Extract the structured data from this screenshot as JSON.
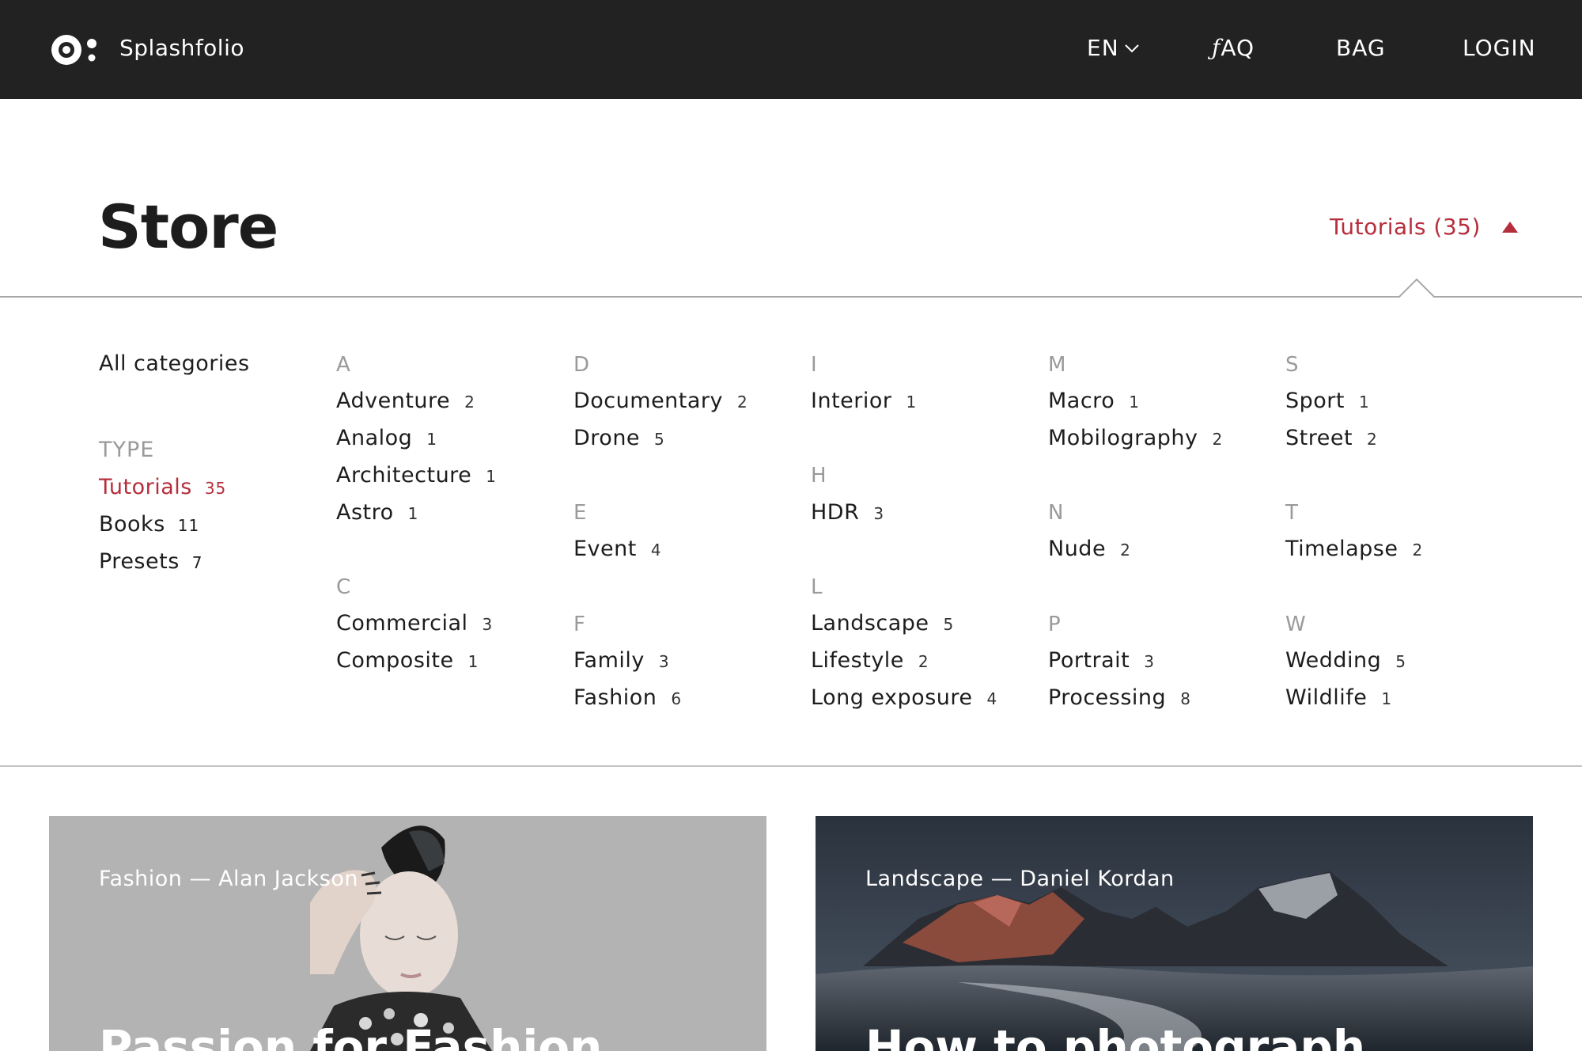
{
  "header": {
    "brand": "Splashfolio",
    "nav": {
      "lang": "EN",
      "faq_prefix": "ƒ",
      "faq_rest": "AQ",
      "bag": "BAG",
      "login": "LOGIN"
    }
  },
  "page": {
    "title": "Store",
    "filter_toggle": "Tutorials (35)"
  },
  "sidebar": {
    "all_categories": "All categories",
    "type_label": "TYPE",
    "types": [
      {
        "label": "Tutorials",
        "count": "35",
        "active": true
      },
      {
        "label": "Books",
        "count": "11"
      },
      {
        "label": "Presets",
        "count": "7"
      }
    ]
  },
  "categories": {
    "col1": [
      {
        "letter": "A",
        "items": [
          {
            "label": "Adventure",
            "count": "2"
          },
          {
            "label": "Analog",
            "count": "1"
          },
          {
            "label": "Architecture",
            "count": "1"
          },
          {
            "label": "Astro",
            "count": "1"
          }
        ]
      },
      {
        "letter": "C",
        "items": [
          {
            "label": "Commercial",
            "count": "3"
          },
          {
            "label": "Composite",
            "count": "1"
          }
        ]
      }
    ],
    "col2": [
      {
        "letter": "D",
        "items": [
          {
            "label": "Documentary",
            "count": "2"
          },
          {
            "label": "Drone",
            "count": "5"
          }
        ]
      },
      {
        "letter": "E",
        "items": [
          {
            "label": "Event",
            "count": "4"
          }
        ]
      },
      {
        "letter": "F",
        "items": [
          {
            "label": "Family",
            "count": "3"
          },
          {
            "label": "Fashion",
            "count": "6"
          }
        ]
      }
    ],
    "col3": [
      {
        "letter": "I",
        "items": [
          {
            "label": "Interior",
            "count": "1"
          }
        ]
      },
      {
        "letter": "H",
        "items": [
          {
            "label": "HDR",
            "count": "3"
          }
        ]
      },
      {
        "letter": "L",
        "items": [
          {
            "label": "Landscape",
            "count": "5"
          },
          {
            "label": "Lifestyle",
            "count": "2"
          },
          {
            "label": "Long exposure",
            "count": "4"
          }
        ]
      }
    ],
    "col4": [
      {
        "letter": "M",
        "items": [
          {
            "label": "Macro",
            "count": "1"
          },
          {
            "label": "Mobilography",
            "count": "2"
          }
        ]
      },
      {
        "letter": "N",
        "items": [
          {
            "label": "Nude",
            "count": "2"
          }
        ]
      },
      {
        "letter": "P",
        "items": [
          {
            "label": "Portrait",
            "count": "3"
          },
          {
            "label": "Processing",
            "count": "8"
          }
        ]
      }
    ],
    "col5": [
      {
        "letter": "S",
        "items": [
          {
            "label": "Sport",
            "count": "1"
          },
          {
            "label": "Street",
            "count": "2"
          }
        ]
      },
      {
        "letter": "T",
        "items": [
          {
            "label": "Timelapse",
            "count": "2"
          }
        ]
      },
      {
        "letter": "W",
        "items": [
          {
            "label": "Wedding",
            "count": "5"
          },
          {
            "label": "Wildlife",
            "count": "1"
          }
        ]
      }
    ]
  },
  "cards": [
    {
      "meta": "Fashion — Alan Jackson",
      "title": "Passion for Fashion"
    },
    {
      "meta": "Landscape — Daniel Kordan",
      "title": "How to photograph"
    }
  ],
  "colors": {
    "accent": "#b62e3c",
    "topbar": "#222222",
    "muted": "#9a9a9a",
    "divider": "#c4c4c4"
  },
  "icons": {
    "logo": "splashfolio-logo-icon",
    "lang_dropdown": "chevron-down-icon",
    "filter_toggle": "caret-up-icon"
  }
}
